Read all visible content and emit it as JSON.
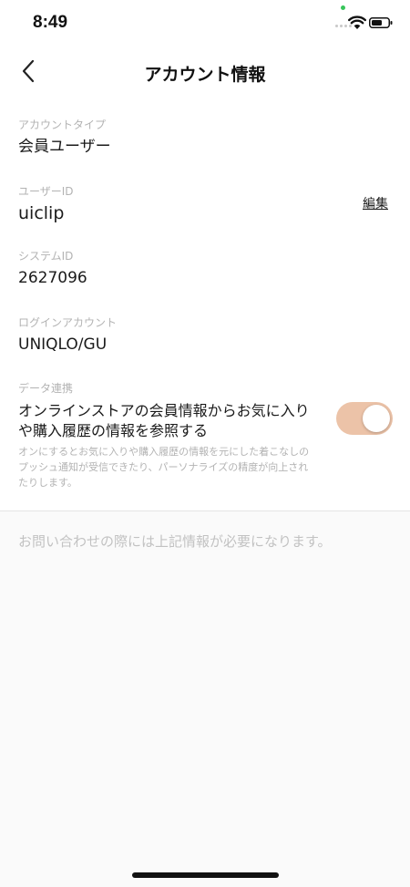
{
  "status_bar": {
    "time": "8:49",
    "icons": [
      "signal-dots-icon",
      "wifi-icon",
      "battery-icon"
    ],
    "camera_indicator_color": "#37c55a"
  },
  "nav": {
    "title": "アカウント情報",
    "back_icon": "chevron-left-icon"
  },
  "account_type": {
    "label": "アカウントタイプ",
    "value": "会員ユーザー"
  },
  "user_id": {
    "label": "ユーザーID",
    "value": "uiclip",
    "edit_label": "編集"
  },
  "system_id": {
    "label": "システムID",
    "value": "2627096"
  },
  "login_account": {
    "label": "ログインアカウント",
    "value": "UNIQLO/GU"
  },
  "data_sync": {
    "label": "データ連携",
    "title": "オンラインストアの会員情報からお気に入りや購入履歴の情報を参照する",
    "description": "オンにするとお気に入りや購入履歴の情報を元にした着こなしのプッシュ通知が受信できたり、パーソナライズの精度が向上されたりします。",
    "toggle_on": true,
    "toggle_color": "#ecc3a8"
  },
  "note": "お問い合わせの際には上記情報が必要になります。"
}
